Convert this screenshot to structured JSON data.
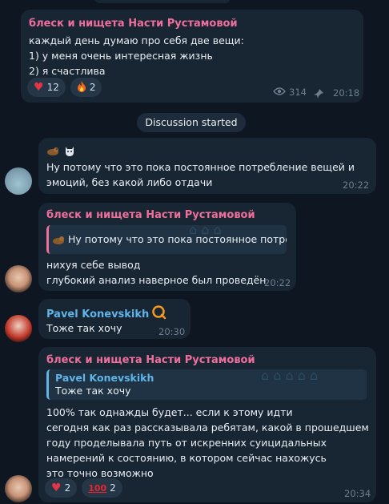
{
  "channel_post": {
    "sender": "блеск и нищета Насти Рустамовой",
    "text": "каждый день думаю про себя две вещи:\n1) у меня очень интересная жизнь\n2) я счастлива",
    "reactions": [
      {
        "emoji_icon": "heart-icon",
        "count": "12"
      },
      {
        "emoji_icon": "fire-icon",
        "count": "2"
      }
    ],
    "views": "314",
    "time": "20:18"
  },
  "discussion_pill": "Discussion started",
  "comments": [
    {
      "sender": "",
      "text": "Ну потому что это пока постоянное потребление вещей и эмоций, без какой либо отдачи",
      "time": "20:22"
    },
    {
      "sender": "блеск и нищета Насти Рустамовой",
      "quote_text": "Ну потому что это пока постоянное потреб...",
      "text": "нихуя себе вывод\nглубокий анализ наверное был проведён",
      "time": "20:22"
    },
    {
      "sender": "Pavel Konevskikh",
      "text": "Тоже так хочу",
      "time": "20:30"
    },
    {
      "sender": "блеск и нищета Насти Рустамовой",
      "quote_sender": "Pavel Konevskikh",
      "quote_text": "Тоже так хочу",
      "text": "100% так однажды будет... если к этому идти\nсегодня как раз рассказывала ребятам, какой в прошедшем году проделывала путь от искренних суицидальных намерений к состоянию, в котором сейчас нахожусь\nэто точно возможно",
      "reactions": [
        {
          "emoji_icon": "heart-icon",
          "count": "2"
        },
        {
          "emoji_icon": "hundred-icon",
          "count": "2"
        }
      ],
      "time": "20:34"
    }
  ],
  "colors": {
    "background": "#0e1621",
    "bubble": "#182533",
    "channel_name": "#ee6f9b",
    "user_name": "#5fb4e8"
  }
}
